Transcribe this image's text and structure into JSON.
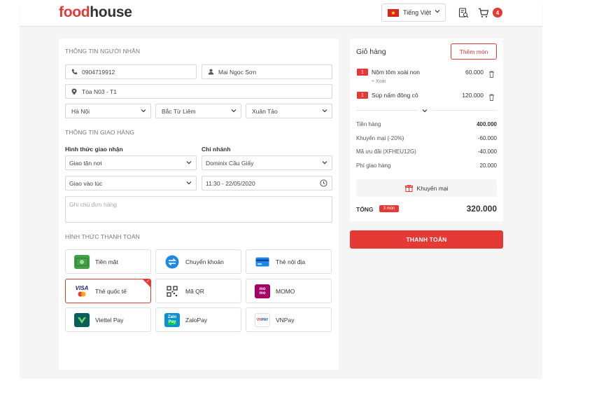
{
  "brand": {
    "part1": "food",
    "part2": "house",
    "accent": "#e53935"
  },
  "header": {
    "language": "Tiếng Việt",
    "cart_count": "4"
  },
  "recipient": {
    "section_title": "THÔNG TIN NGƯỜI NHẬN",
    "phone": "0904719912",
    "name": "Mai Ngọc Sơn",
    "address": "Tòa N03 - T1",
    "city": "Hà Nội",
    "district": "Bắc Từ Liêm",
    "ward": "Xuân Tảo"
  },
  "delivery": {
    "section_title": "THÔNG TIN GIAO HÀNG",
    "method_label": "Hình thức giao nhận",
    "branch_label": "Chi nhánh",
    "method_value": "Giao tận nơi",
    "branch_value": "Dominix Cầu Giấy",
    "time_mode": "Giao vào lúc",
    "time_value": "11:30 - 22/05/2020",
    "note_placeholder": "Ghi chú đơn hàng"
  },
  "payment": {
    "section_title": "HÌNH THỨC THANH TOÁN",
    "methods": [
      {
        "label": "Tiền mặt",
        "icon": "cash-icon"
      },
      {
        "label": "Chuyển khoản",
        "icon": "transfer-icon"
      },
      {
        "label": "Thẻ nội địa",
        "icon": "card-icon"
      },
      {
        "label": "Thẻ quốc tế",
        "icon": "visa-icon",
        "selected": true
      },
      {
        "label": "Mã QR",
        "icon": "qr-icon"
      },
      {
        "label": "MOMO",
        "icon": "momo-icon"
      },
      {
        "label": "Viettel Pay",
        "icon": "viettelpay-icon"
      },
      {
        "label": "ZaloPay",
        "icon": "zalopay-icon"
      },
      {
        "label": "VNPay",
        "icon": "vnpay-icon"
      }
    ]
  },
  "cart": {
    "title": "Giỏ hàng",
    "add_label": "Thêm món",
    "items": [
      {
        "qty": "1",
        "name": "Nộm tôm xoài non",
        "note": "+ Xoài",
        "price": "60.000"
      },
      {
        "qty": "1",
        "name": "Súp nấm đông cô",
        "price": "120.000"
      }
    ],
    "summary": [
      {
        "label": "Tiền hàng",
        "value": "400.000"
      },
      {
        "label": "Khuyến mại (-20%)",
        "value": "-60.000"
      },
      {
        "label": "Mã ưu đãi (XFHEU12G)",
        "value": "-40.000"
      },
      {
        "label": "Phí giao hàng",
        "value": "20.000"
      }
    ],
    "gift_label": "Khuyến mại",
    "total_label": "TỔNG",
    "total_badge": "3 món",
    "total_value": "320.000",
    "checkout_label": "THANH TOÁN"
  }
}
